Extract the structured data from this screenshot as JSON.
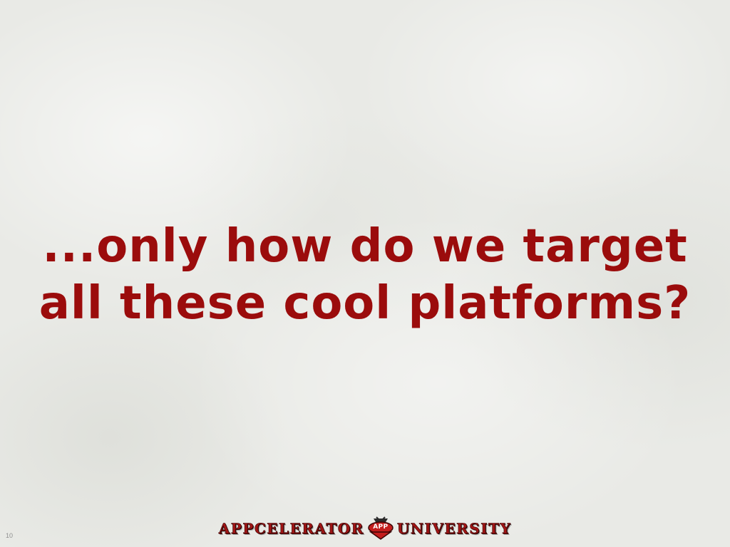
{
  "slide": {
    "headline_line1": "...only how do we target",
    "headline_line2": "all these cool platforms?",
    "number": "10"
  },
  "footer_logo": {
    "left_word": "APPCELERATOR",
    "badge": "APP",
    "right_word": "UNIVERSITY"
  },
  "colors": {
    "headline": "#9b0c0c",
    "background": "#e9eae6",
    "logo_red": "#a11515"
  }
}
